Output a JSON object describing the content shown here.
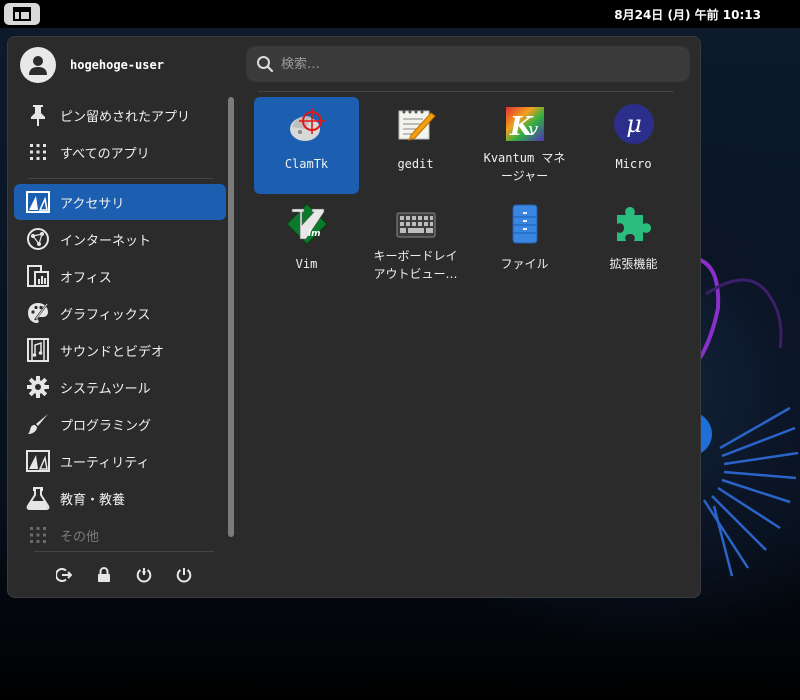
{
  "topbar": {
    "clock": "8月24日 (月) 午前 10:13",
    "activities_icon": "window-grid-icon"
  },
  "user": {
    "name": "hogehoge-user",
    "avatar_icon": "user-avatar-icon"
  },
  "search": {
    "placeholder": "検索…"
  },
  "sidebar": {
    "items": [
      {
        "label": "ピン留めされたアプリ",
        "icon": "pin-icon"
      },
      {
        "label": "すべてのアプリ",
        "icon": "grid-dots-icon"
      },
      {
        "label": "アクセサリ",
        "icon": "accessories-icon",
        "active": true
      },
      {
        "label": "インターネット",
        "icon": "globe-icon"
      },
      {
        "label": "オフィス",
        "icon": "office-icon"
      },
      {
        "label": "グラフィックス",
        "icon": "palette-icon"
      },
      {
        "label": "サウンドとビデオ",
        "icon": "film-icon"
      },
      {
        "label": "システムツール",
        "icon": "gear-icon"
      },
      {
        "label": "プログラミング",
        "icon": "brush-icon"
      },
      {
        "label": "ユーティリティ",
        "icon": "utilities-icon"
      },
      {
        "label": "教育・教養",
        "icon": "flask-icon"
      },
      {
        "label": "その他",
        "icon": "grid-dots-icon",
        "dimmed": true
      }
    ]
  },
  "power": {
    "buttons": [
      "logout-icon",
      "lock-icon",
      "restart-icon",
      "power-icon"
    ]
  },
  "apps": [
    {
      "name": "ClamTk",
      "icon": "clamtk-icon",
      "selected": true
    },
    {
      "name": "gedit",
      "icon": "gedit-icon"
    },
    {
      "name": "Kvantum マネージャー",
      "icon": "kvantum-icon"
    },
    {
      "name": "Micro",
      "icon": "micro-icon"
    },
    {
      "name": "Vim",
      "icon": "vim-icon"
    },
    {
      "name": "キーボードレイアウトビュー…",
      "icon": "keyboard-icon"
    },
    {
      "name": "ファイル",
      "icon": "files-icon"
    },
    {
      "name": "拡張機能",
      "icon": "puzzle-icon"
    }
  ],
  "colors": {
    "accent": "#1c5fb0",
    "panel": "#2b2b2b",
    "topbar": "#000000"
  }
}
